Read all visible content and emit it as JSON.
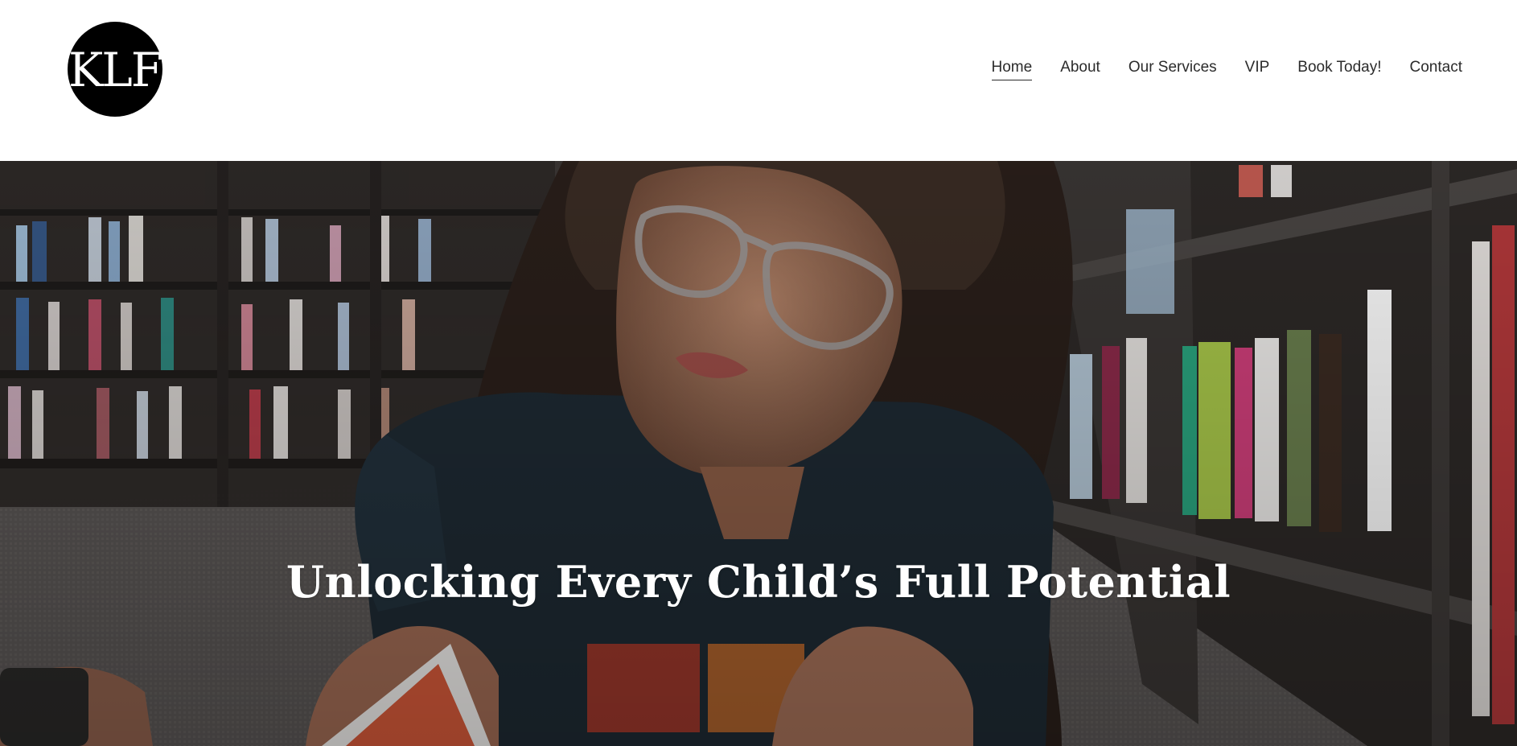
{
  "logo": {
    "text": "KLF"
  },
  "nav": {
    "items": [
      {
        "label": "Home",
        "active": true
      },
      {
        "label": "About",
        "active": false
      },
      {
        "label": "Our Services",
        "active": false
      },
      {
        "label": "VIP",
        "active": false
      },
      {
        "label": "Book Today!",
        "active": false
      },
      {
        "label": "Contact",
        "active": false
      }
    ]
  },
  "hero": {
    "title": "Unlocking Every Child’s Full Potential",
    "image_alt": "Girl with glasses lying on bookstore carpet reading a book"
  },
  "colors": {
    "header_bg": "#ffffff",
    "logo_bg": "#000000",
    "logo_text": "#ffffff",
    "nav_text": "#2b2b2b",
    "hero_text": "#ffffff"
  }
}
